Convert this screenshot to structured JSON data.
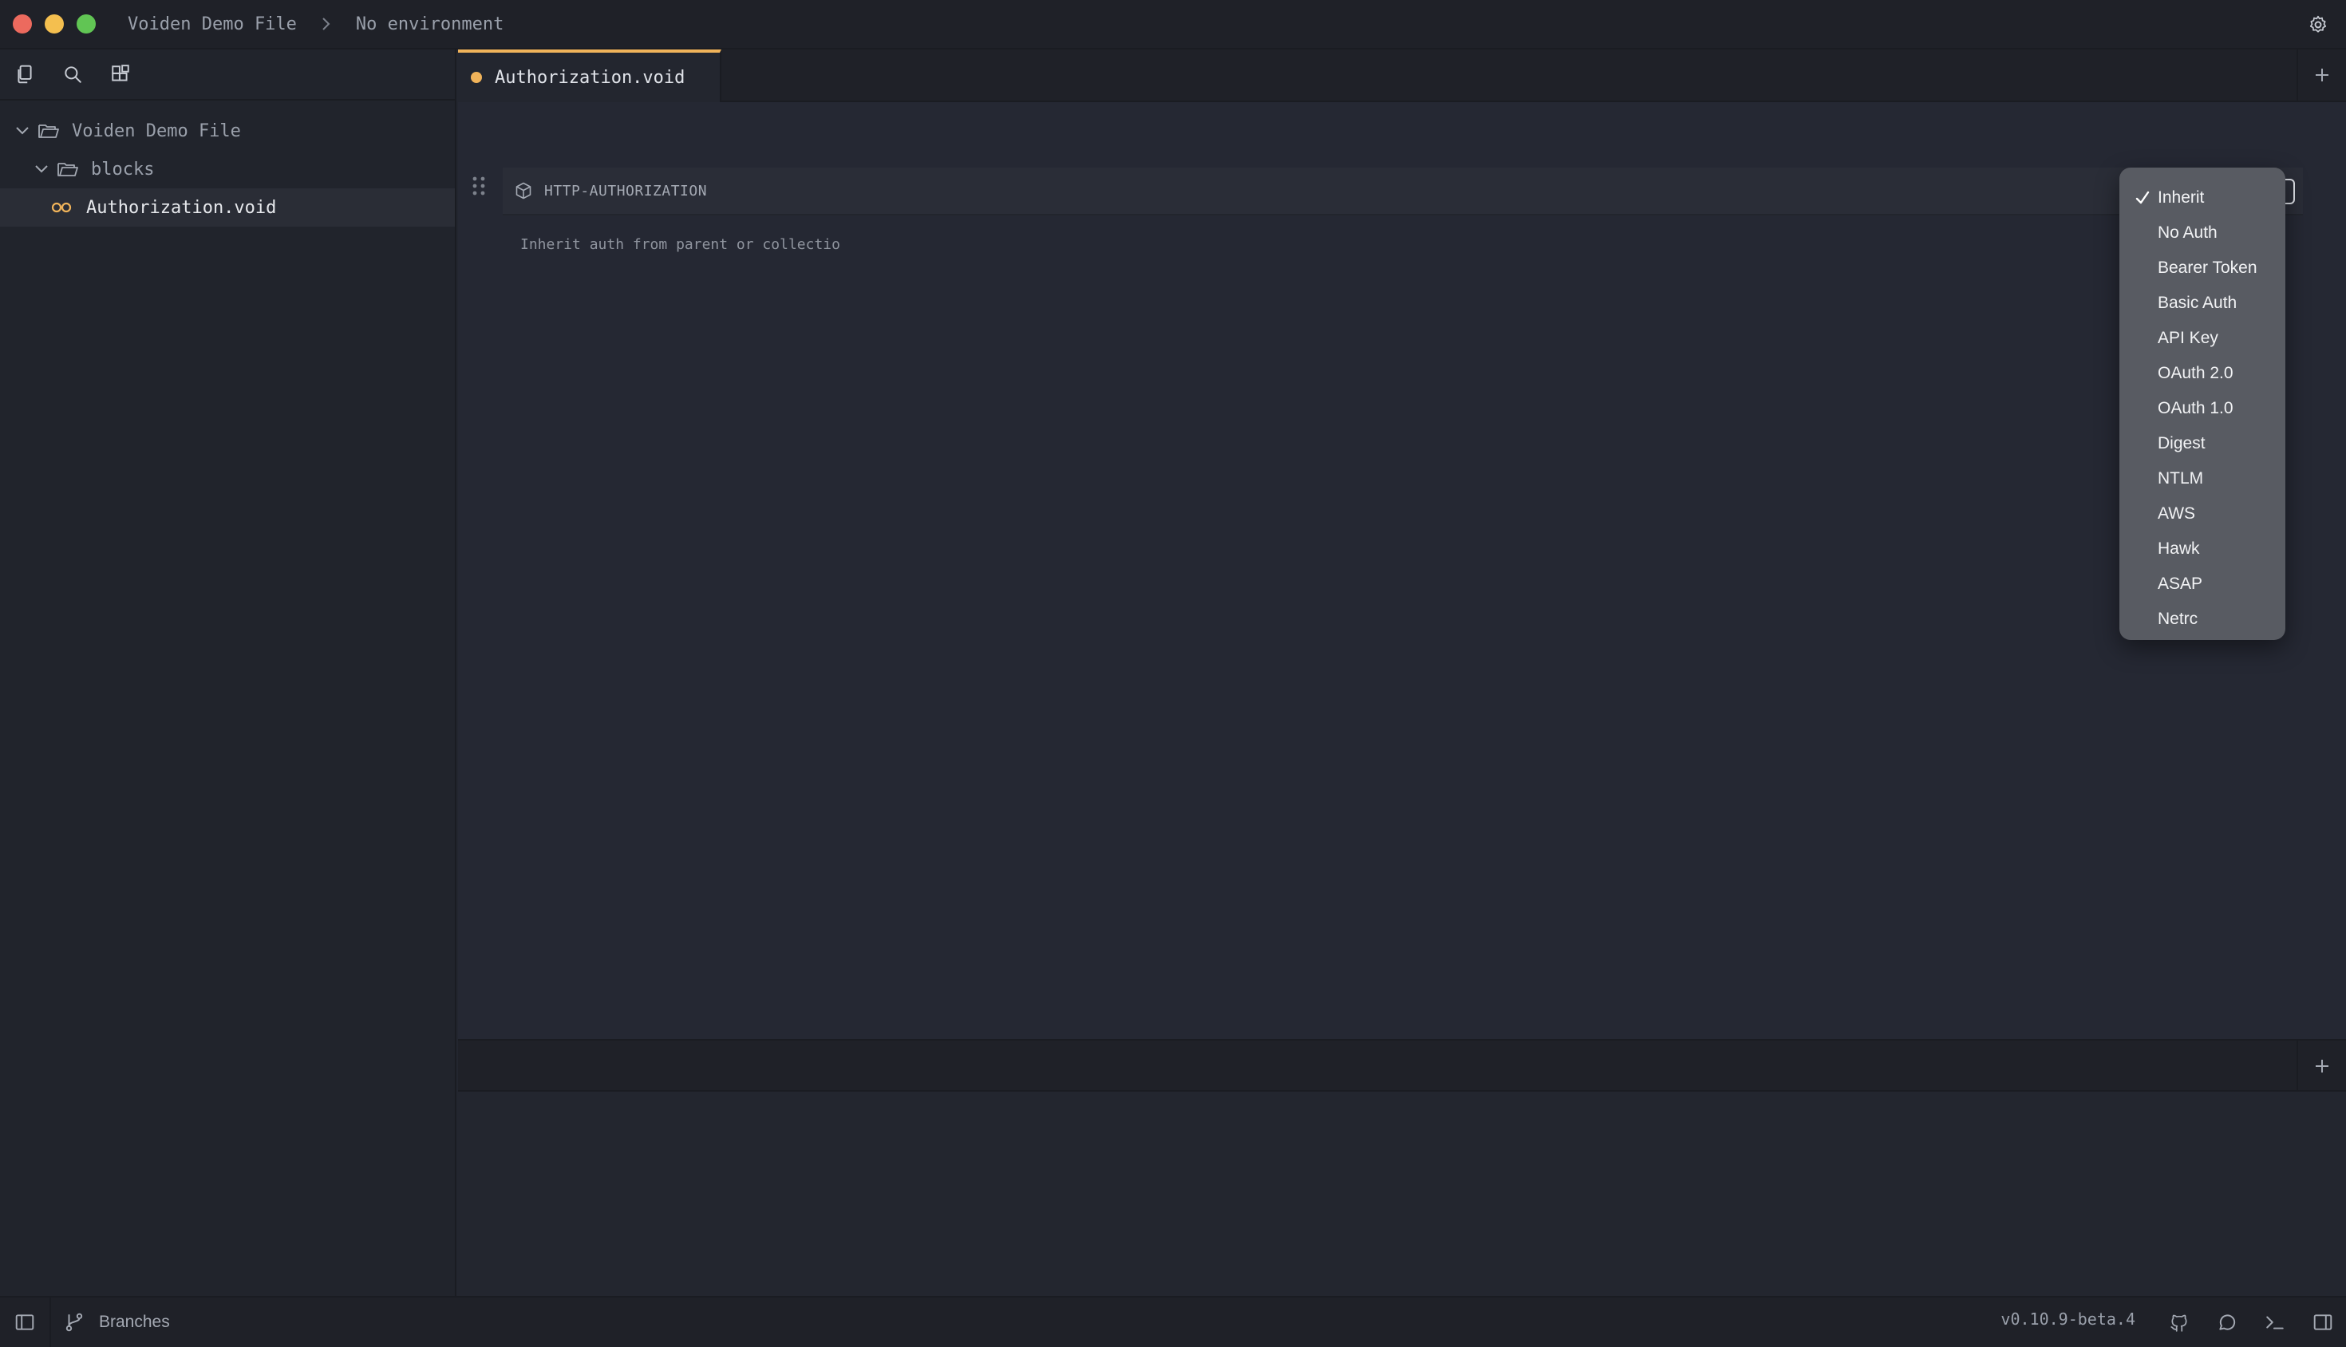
{
  "titlebar": {
    "project": "Voiden Demo File",
    "environment": "No environment"
  },
  "sidebar": {
    "tree": {
      "root_label": "Voiden Demo File",
      "folder_label": "blocks",
      "file_label": "Authorization.void"
    }
  },
  "editor": {
    "active_tab": "Authorization.void",
    "block": {
      "title": "HTTP-AUTHORIZATION",
      "description": "Inherit auth from parent or collectio",
      "auth_options": [
        "Inherit",
        "No Auth",
        "Bearer Token",
        "Basic Auth",
        "API Key",
        "OAuth 2.0",
        "OAuth 1.0",
        "Digest",
        "NTLM",
        "AWS",
        "Hawk",
        "ASAP",
        "Netrc"
      ],
      "selected_option": "Inherit"
    }
  },
  "statusbar": {
    "branches_label": "Branches",
    "version": "v0.10.9-beta.4"
  },
  "colors": {
    "accent": "#f0b35a",
    "background": "#23262f",
    "dropdown_bg": "#585b62"
  }
}
